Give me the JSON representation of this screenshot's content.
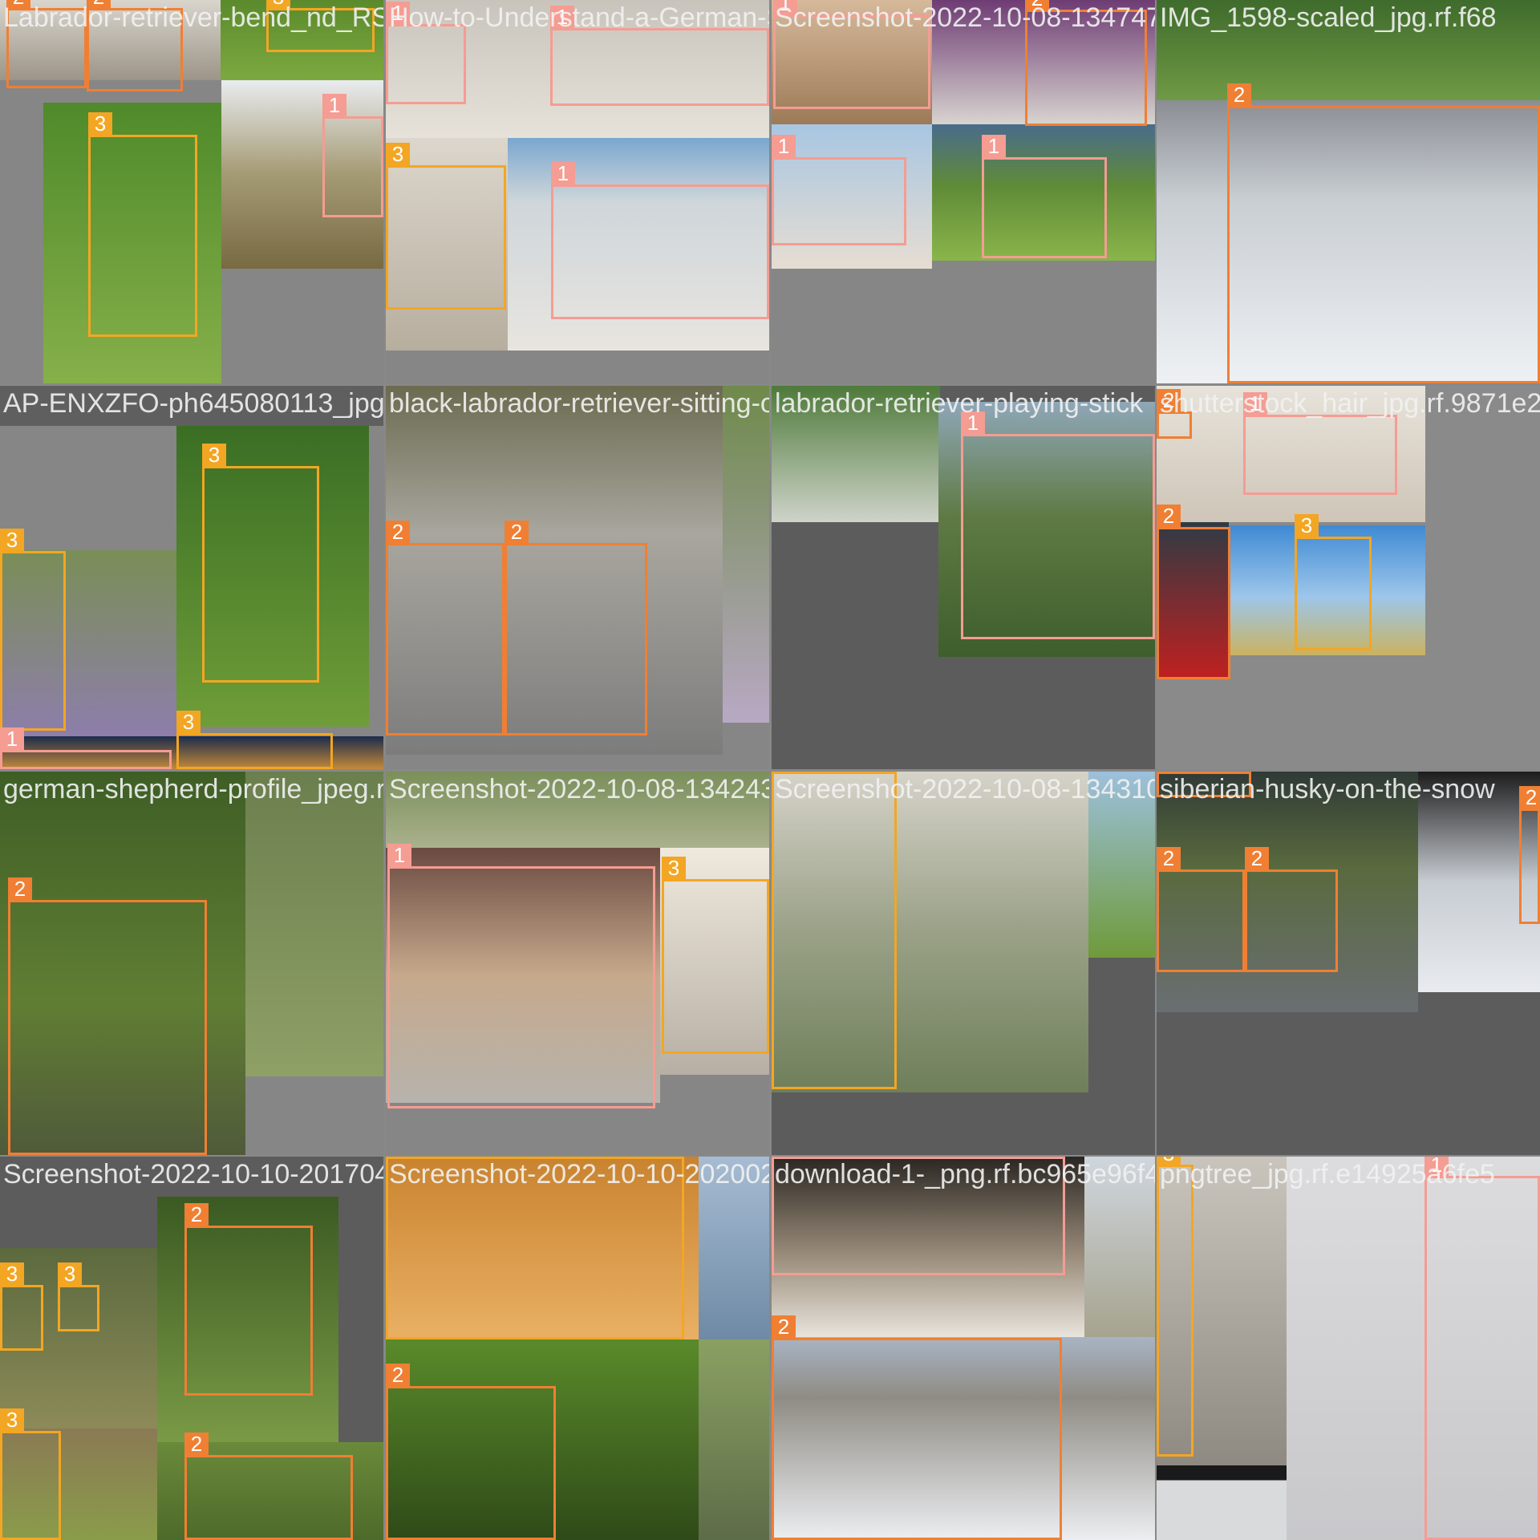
{
  "colors": {
    "class_1": "#f59c93",
    "class_2": "#f07f33",
    "class_3": "#f3a623",
    "canvas": "#888888"
  },
  "tiles": [
    {
      "filename": "Labrador-retriever-bend_nd_RSRT_low-fed_Understand-a-German",
      "labels": [
        "2",
        "2",
        "3",
        "3",
        "1"
      ]
    },
    {
      "filename": "How-to-Understand-a-German-Shepherd",
      "labels": [
        "1",
        "1",
        "3",
        "1"
      ]
    },
    {
      "filename": "Screenshot-2022-10-08-134747_png.rf",
      "labels": [
        "1",
        "2",
        "1",
        "1"
      ]
    },
    {
      "filename": "IMG_1598-scaled_jpg.rf.f68",
      "labels": [
        "2"
      ]
    },
    {
      "filename": "AP-ENXZFO-ph645080113_jpg.rf.9abca495a419",
      "labels": [
        "3",
        "3",
        "1",
        "3"
      ]
    },
    {
      "filename": "black-labrador-retriever-sitting-on-the",
      "labels": [
        "2",
        "2"
      ]
    },
    {
      "filename": "labrador-retriever-playing-stick",
      "labels": [
        "1"
      ]
    },
    {
      "filename": "shutterstock_hair_jpg.rf.9871e29a4",
      "labels": [
        "2",
        "1",
        "2",
        "3"
      ]
    },
    {
      "filename": "german-shepherd-profile_jpeg.rf.e96b884",
      "labels": [
        "2"
      ]
    },
    {
      "filename": "Screenshot-2022-10-08-134243_png.rf.e75",
      "labels": [
        "1",
        "3"
      ]
    },
    {
      "filename": "Screenshot-2022-10-08-134310_png.rf.4b",
      "labels": [
        "3"
      ]
    },
    {
      "filename": "siberian-husky-on-the-snow",
      "labels": [
        "2",
        "2",
        "2",
        "2"
      ]
    },
    {
      "filename": "Screenshot-2022-10-10-201704_png.rf.27",
      "labels": [
        "3",
        "3",
        "2",
        "3",
        "2"
      ]
    },
    {
      "filename": "Screenshot-2022-10-10-202002_png.rf.384",
      "labels": [
        "3",
        "2"
      ]
    },
    {
      "filename": "download-1-_png.rf.bc965e96f48c",
      "labels": [
        "1",
        "2"
      ]
    },
    {
      "filename": "pngtree_jpg.rf.e14925a6fe5",
      "labels": [
        "3",
        "1"
      ]
    }
  ]
}
